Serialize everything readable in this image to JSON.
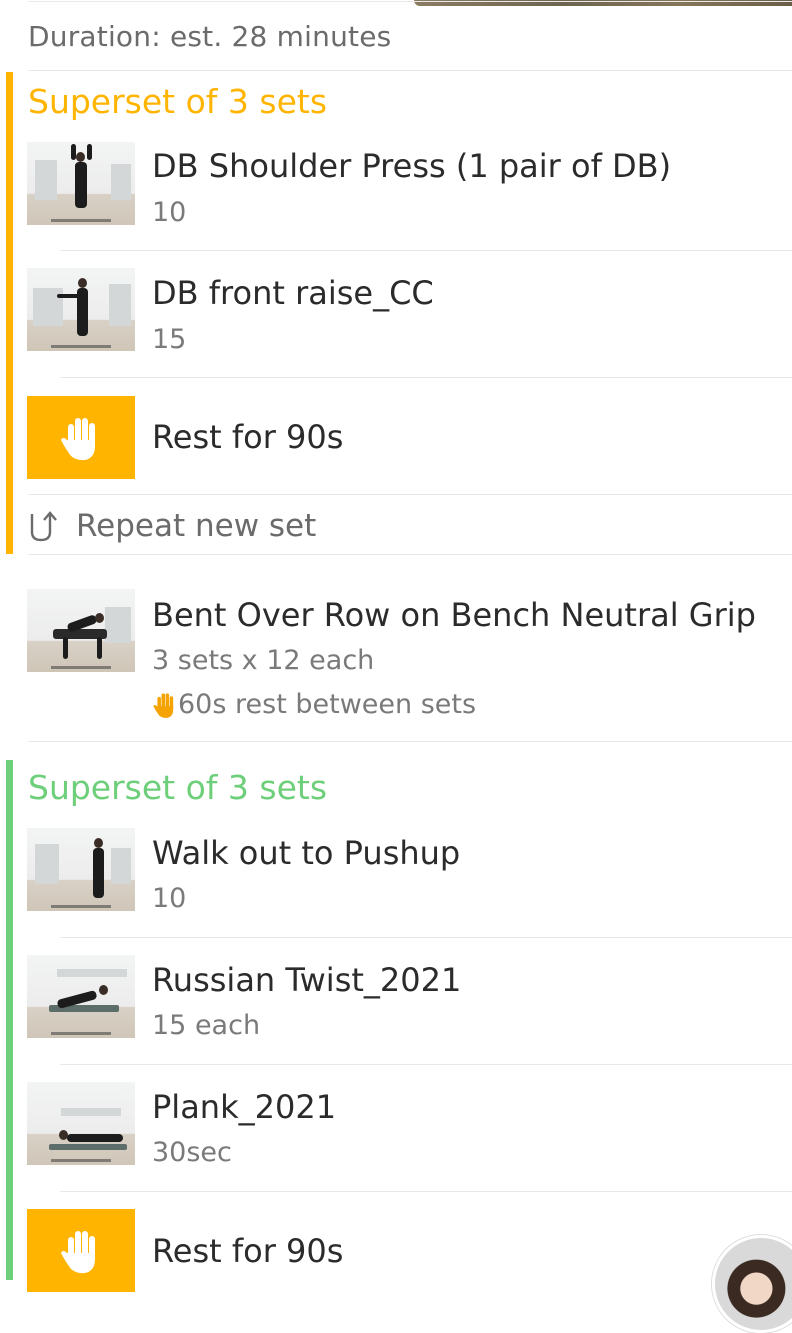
{
  "duration": "Duration: est. 28 minutes",
  "colors": {
    "superset_yellow": "#ffb400",
    "superset_green": "#6ecf7a",
    "rest_box": "#ffb400"
  },
  "superset1": {
    "title": "Superset of 3 sets",
    "exercises": [
      {
        "name": "DB Shoulder Press (1 pair of DB)",
        "reps": "10",
        "thumbnail": "exercise-video-thumbnail"
      },
      {
        "name": "DB front raise_CC",
        "reps": "15",
        "thumbnail": "exercise-video-thumbnail"
      }
    ],
    "rest": {
      "label": "Rest for 90s",
      "icon": "hand-icon"
    },
    "repeat": {
      "label": "Repeat new set",
      "icon": "repeat-arrow-icon"
    }
  },
  "single": {
    "name": "Bent Over Row on Bench Neutral Grip",
    "sets": "3 sets x 12 each",
    "rest_note": "60s rest between sets",
    "rest_icon": "hand-emoji-icon"
  },
  "superset2": {
    "title": "Superset of 3 sets",
    "exercises": [
      {
        "name": "Walk out to Pushup",
        "reps": "10"
      },
      {
        "name": "Russian Twist_2021",
        "reps": "15 each"
      },
      {
        "name": "Plank_2021",
        "reps": "30sec"
      }
    ],
    "rest": {
      "label": "Rest for 90s",
      "icon": "hand-icon"
    }
  },
  "avatar": {
    "icon": "coach-avatar"
  }
}
